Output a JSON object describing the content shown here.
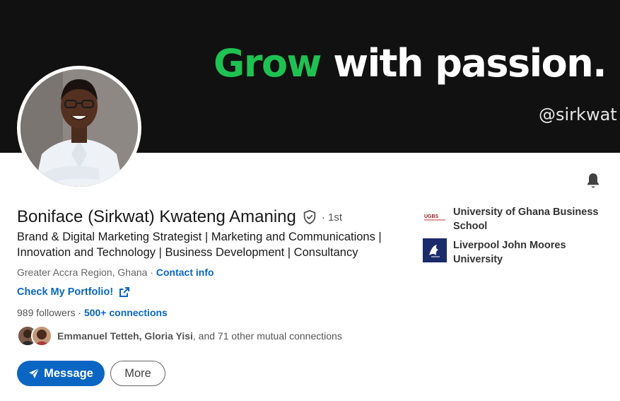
{
  "banner": {
    "headline_green": "Grow",
    "headline_white": "with passion.",
    "handle": "@sirkwat",
    "colors": {
      "background": "#111111",
      "green": "#1fc252",
      "white": "#ffffff"
    }
  },
  "profile": {
    "name": "Boniface (Sirkwat) Kwateng Amaning",
    "degree": "· 1st",
    "headline": "Brand & Digital Marketing Strategist | Marketing and Communications | Innovation and Technology | Business Development | Consultancy",
    "location": "Greater Accra Region, Ghana",
    "separator": " · ",
    "contact_info": "Contact info",
    "portfolio_link": "Check My Portfolio!",
    "followers": "989 followers",
    "connections_sep": " · ",
    "connections": "500+ connections",
    "mutual_names": "Emmanuel Tetteh, Gloria Yisi",
    "mutual_rest": ", and 71 other mutual connections"
  },
  "actions": {
    "message": "Message",
    "more": "More"
  },
  "education": [
    {
      "name": "University of Ghana Business School",
      "logo_text": "UGBS"
    },
    {
      "name": "Liverpool John Moores University"
    }
  ],
  "icons": {
    "bell": "bell-icon",
    "verified": "verified-shield-icon",
    "external": "external-link-icon",
    "send": "send-icon"
  },
  "colors": {
    "link": "#0a66c2",
    "primary_button": "#0a66c2",
    "text": "#191919",
    "muted": "#666666"
  }
}
